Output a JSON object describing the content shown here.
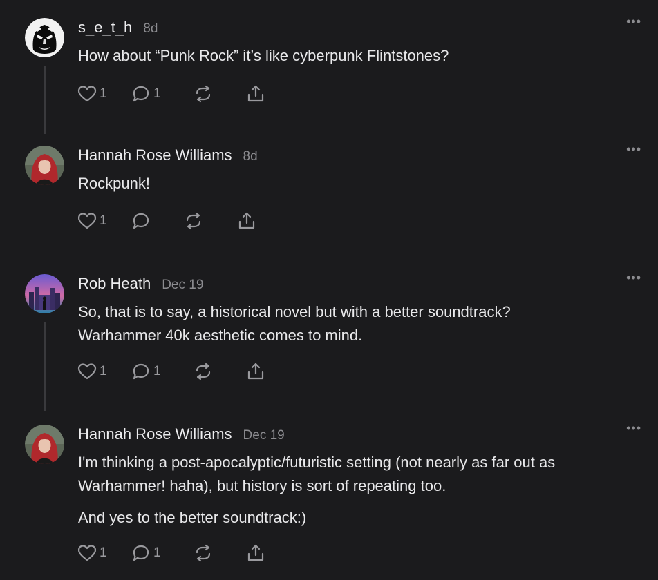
{
  "posts": [
    {
      "author": "s_e_t_h",
      "time": "8d",
      "paragraphs": [
        "How about “Punk Rock” it’s like cyberpunk Flintstones?"
      ],
      "like_count": "1",
      "reply_count": "1",
      "more_icon": "ellipsis-icon",
      "avatar_icon": "mask-face-avatar"
    },
    {
      "author": "Hannah Rose Williams",
      "time": "8d",
      "paragraphs": [
        "Rockpunk!"
      ],
      "like_count": "1",
      "reply_count": "",
      "more_icon": "ellipsis-icon",
      "avatar_icon": "red-hair-portrait-avatar"
    },
    {
      "author": "Rob Heath",
      "time": "Dec 19",
      "paragraphs": [
        "So, that is to say, a historical novel but with a better soundtrack? Warhammer 40k aesthetic comes to mind."
      ],
      "like_count": "1",
      "reply_count": "1",
      "more_icon": "ellipsis-icon",
      "avatar_icon": "city-silhouette-avatar"
    },
    {
      "author": "Hannah Rose Williams",
      "time": "Dec 19",
      "paragraphs": [
        "I'm thinking a post-apocalyptic/futuristic setting (not nearly as far out as Warhammer! haha), but history is sort of repeating too.",
        "And yes to the better soundtrack:)"
      ],
      "like_count": "1",
      "reply_count": "1",
      "more_icon": "ellipsis-icon",
      "avatar_icon": "red-hair-portrait-avatar"
    }
  ],
  "icons": {
    "like": "heart-icon",
    "reply": "comment-bubble-icon",
    "restack": "restack-arrows-icon",
    "share": "share-upload-icon"
  },
  "colors": {
    "background": "#1b1b1d",
    "text": "#e8e8ea",
    "muted": "#8c8c90",
    "thread_line": "#3a3a3d",
    "accent_red": "#b0282c"
  }
}
